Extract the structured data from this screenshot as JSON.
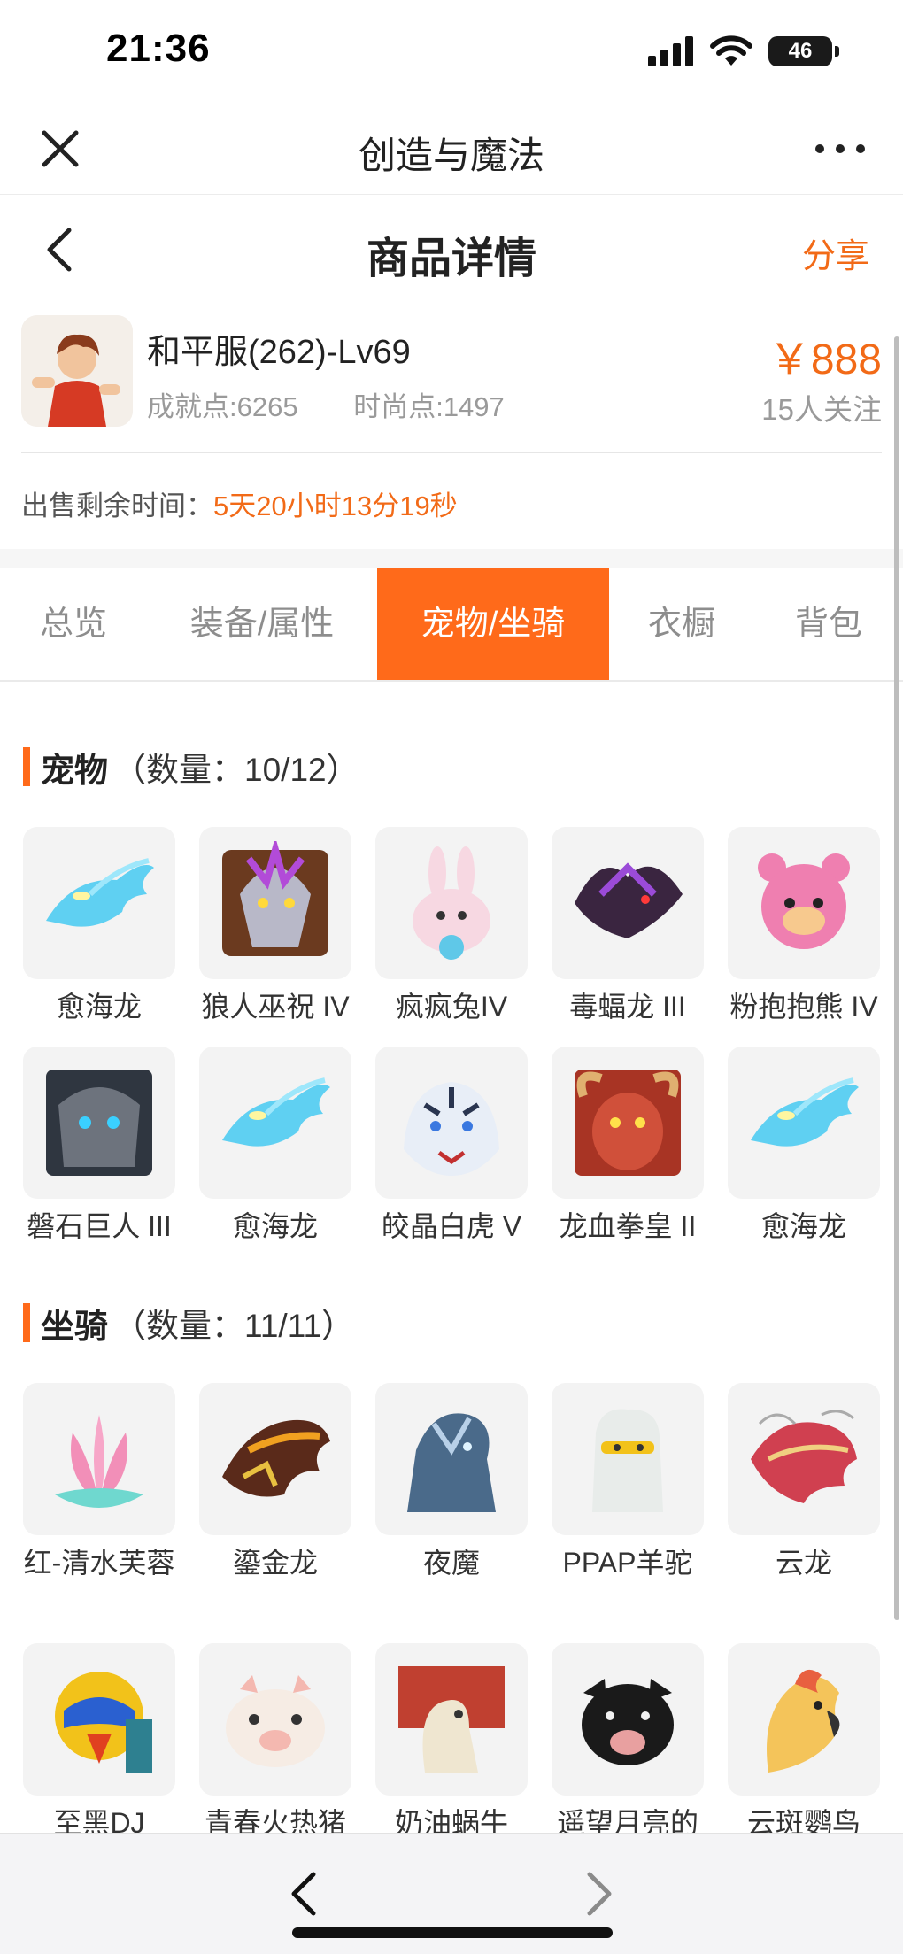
{
  "status_bar": {
    "time": "21:36",
    "battery": "46"
  },
  "app_header": {
    "title": "创造与魔法"
  },
  "page_header": {
    "title": "商品详情",
    "share_label": "分享"
  },
  "product": {
    "name": "和平服(262)-Lv69",
    "achievement": "成就点:6265",
    "fashion": "时尚点:1497",
    "price": "￥888",
    "followers": "15人关注"
  },
  "timer": {
    "label": "出售剩余时间：",
    "value": "5天20小时13分19秒"
  },
  "tabs": [
    "总览",
    "装备/属性",
    "宠物/坐骑",
    "衣橱",
    "背包"
  ],
  "active_tab": "宠物/坐骑",
  "pets": {
    "title": "宠物",
    "count": "（数量：10/12）",
    "items": [
      {
        "name": "愈海龙",
        "icon": "ice-dragon-icon"
      },
      {
        "name": "狼人巫祝 IV",
        "icon": "werewolf-shaman-icon"
      },
      {
        "name": "疯疯兔IV",
        "icon": "crazy-rabbit-icon"
      },
      {
        "name": "毒蝠龙 III",
        "icon": "venom-bat-dragon-icon"
      },
      {
        "name": "粉抱抱熊 IV",
        "icon": "pink-hug-bear-icon"
      },
      {
        "name": "磐石巨人 III",
        "icon": "rock-giant-icon"
      },
      {
        "name": "愈海龙",
        "icon": "ice-dragon-icon"
      },
      {
        "name": "皎晶白虎 V",
        "icon": "crystal-white-tiger-icon"
      },
      {
        "name": "龙血拳皇 II",
        "icon": "dragon-blood-boxer-icon"
      },
      {
        "name": "愈海龙",
        "icon": "ice-dragon-icon"
      }
    ]
  },
  "mounts": {
    "title": "坐骑",
    "count": "（数量：11/11）",
    "items": [
      {
        "name": "红-清水芙蓉",
        "icon": "lotus-icon"
      },
      {
        "name": "鎏金龙",
        "icon": "gilded-dragon-icon"
      },
      {
        "name": "夜魔",
        "icon": "night-demon-icon"
      },
      {
        "name": "PPAP羊驼",
        "icon": "alpaca-icon"
      },
      {
        "name": "云龙",
        "icon": "cloud-dragon-icon"
      },
      {
        "name": "至黑DJ",
        "icon": "dj-helmet-icon"
      },
      {
        "name": "青春火热猪",
        "icon": "pig-icon"
      },
      {
        "name": "奶油蜗牛",
        "icon": "cream-snail-icon"
      },
      {
        "name": "遥望月亮的",
        "icon": "black-pig-icon"
      },
      {
        "name": "云斑鹦鸟",
        "icon": "parrot-icon"
      }
    ]
  },
  "colors": {
    "accent": "#ff6a1a",
    "accent_text": "#f26a17",
    "muted_text": "#9a9a9a"
  }
}
